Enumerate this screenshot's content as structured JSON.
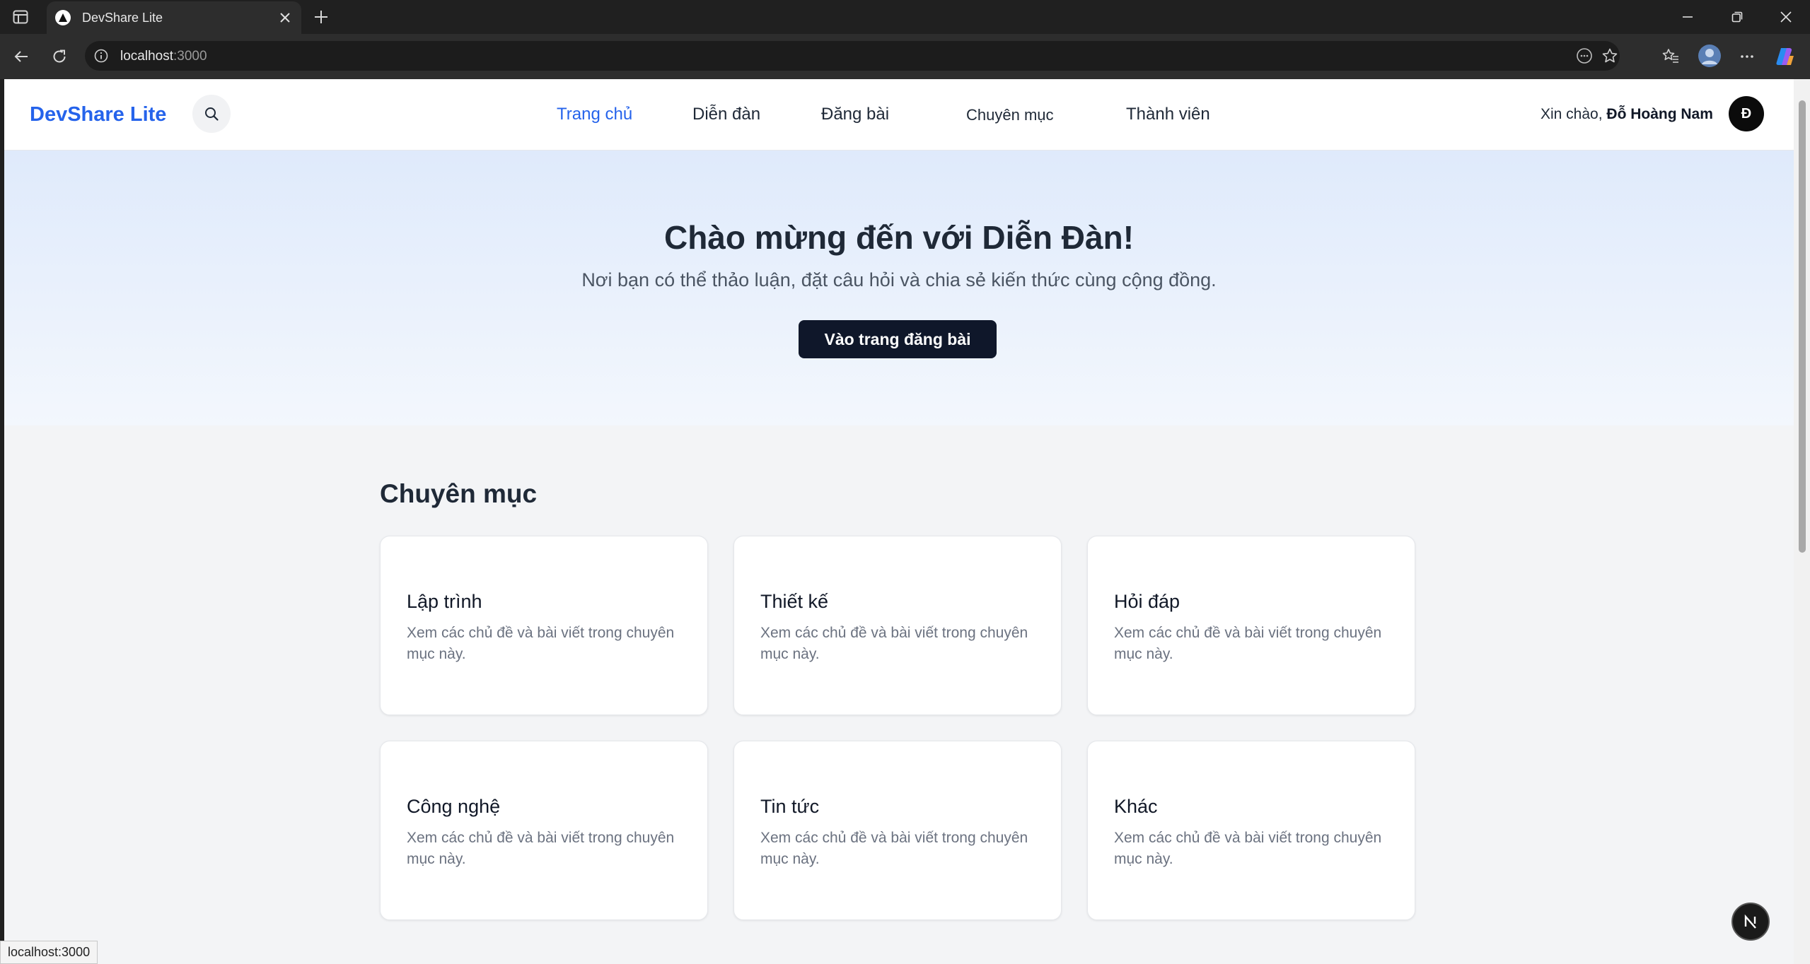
{
  "browser": {
    "tab_title": "DevShare Lite",
    "url_host": "localhost",
    "url_port": ":3000",
    "status_url": "localhost:3000"
  },
  "site": {
    "brand": "DevShare Lite",
    "nav": [
      {
        "label": "Trang chủ",
        "active": true
      },
      {
        "label": "Diễn đàn"
      },
      {
        "label": "Đăng bài"
      },
      {
        "label": "Chuyên mục"
      },
      {
        "label": "Thành viên"
      }
    ],
    "greeting_prefix": "Xin chào, ",
    "user_name": "Đỗ Hoàng Nam",
    "avatar_initial": "Đ"
  },
  "hero": {
    "title": "Chào mừng đến với Diễn Đàn!",
    "subtitle": "Nơi bạn có thể thảo luận, đặt câu hỏi và chia sẻ kiến thức cùng cộng đồng.",
    "button": "Vào trang đăng bài"
  },
  "categories": {
    "heading": "Chuyên mục",
    "items": [
      {
        "title": "Lập trình",
        "desc": "Xem các chủ đề và bài viết trong chuyên mục này."
      },
      {
        "title": "Thiết kế",
        "desc": "Xem các chủ đề và bài viết trong chuyên mục này."
      },
      {
        "title": "Hỏi đáp",
        "desc": "Xem các chủ đề và bài viết trong chuyên mục này."
      },
      {
        "title": "Công nghệ",
        "desc": "Xem các chủ đề và bài viết trong chuyên mục này."
      },
      {
        "title": "Tin tức",
        "desc": "Xem các chủ đề và bài viết trong chuyên mục này."
      },
      {
        "title": "Khác",
        "desc": "Xem các chủ đề và bài viết trong chuyên mục này."
      }
    ]
  },
  "colors": {
    "accent": "#2563eb",
    "dark_button": "#0f172a",
    "page_bg": "#f3f4f6"
  },
  "icons": {
    "tab_toggle": "tab-actions-icon",
    "back": "back-arrow-icon",
    "reload": "reload-icon",
    "site_info": "info-icon",
    "read_mode": "reading-mode-icon",
    "favorite": "star-icon",
    "favorites": "favorites-icon",
    "profile": "profile-avatar-icon",
    "menu": "more-icon",
    "copilot": "copilot-icon",
    "search": "search-icon",
    "next": "nextjs-badge-icon"
  }
}
